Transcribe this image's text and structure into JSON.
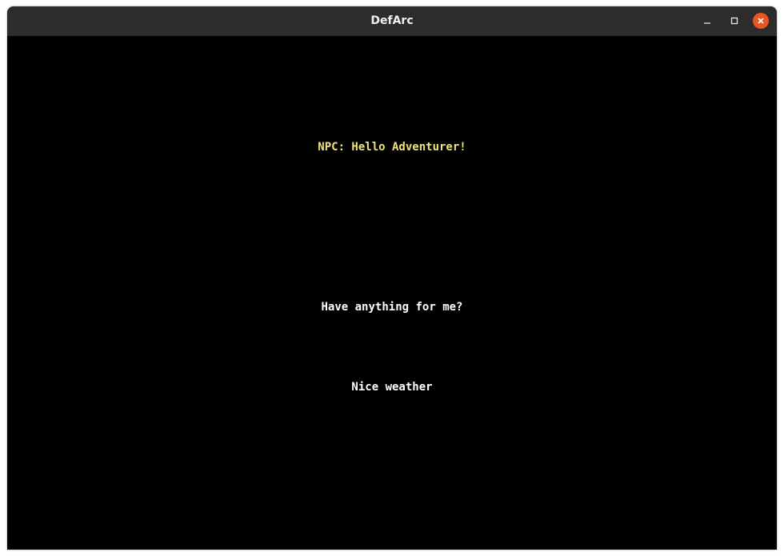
{
  "window": {
    "title": "DefArc",
    "controls": {
      "minimize_icon": "minimize-icon",
      "maximize_icon": "maximize-icon",
      "close_icon": "close-icon",
      "close_color": "#e95420"
    }
  },
  "dialogue": {
    "npc_line": "NPC: Hello Adventurer!",
    "npc_color": "#eee37a",
    "options": [
      {
        "label": "Have anything for me?"
      },
      {
        "label": "Nice weather"
      }
    ]
  }
}
